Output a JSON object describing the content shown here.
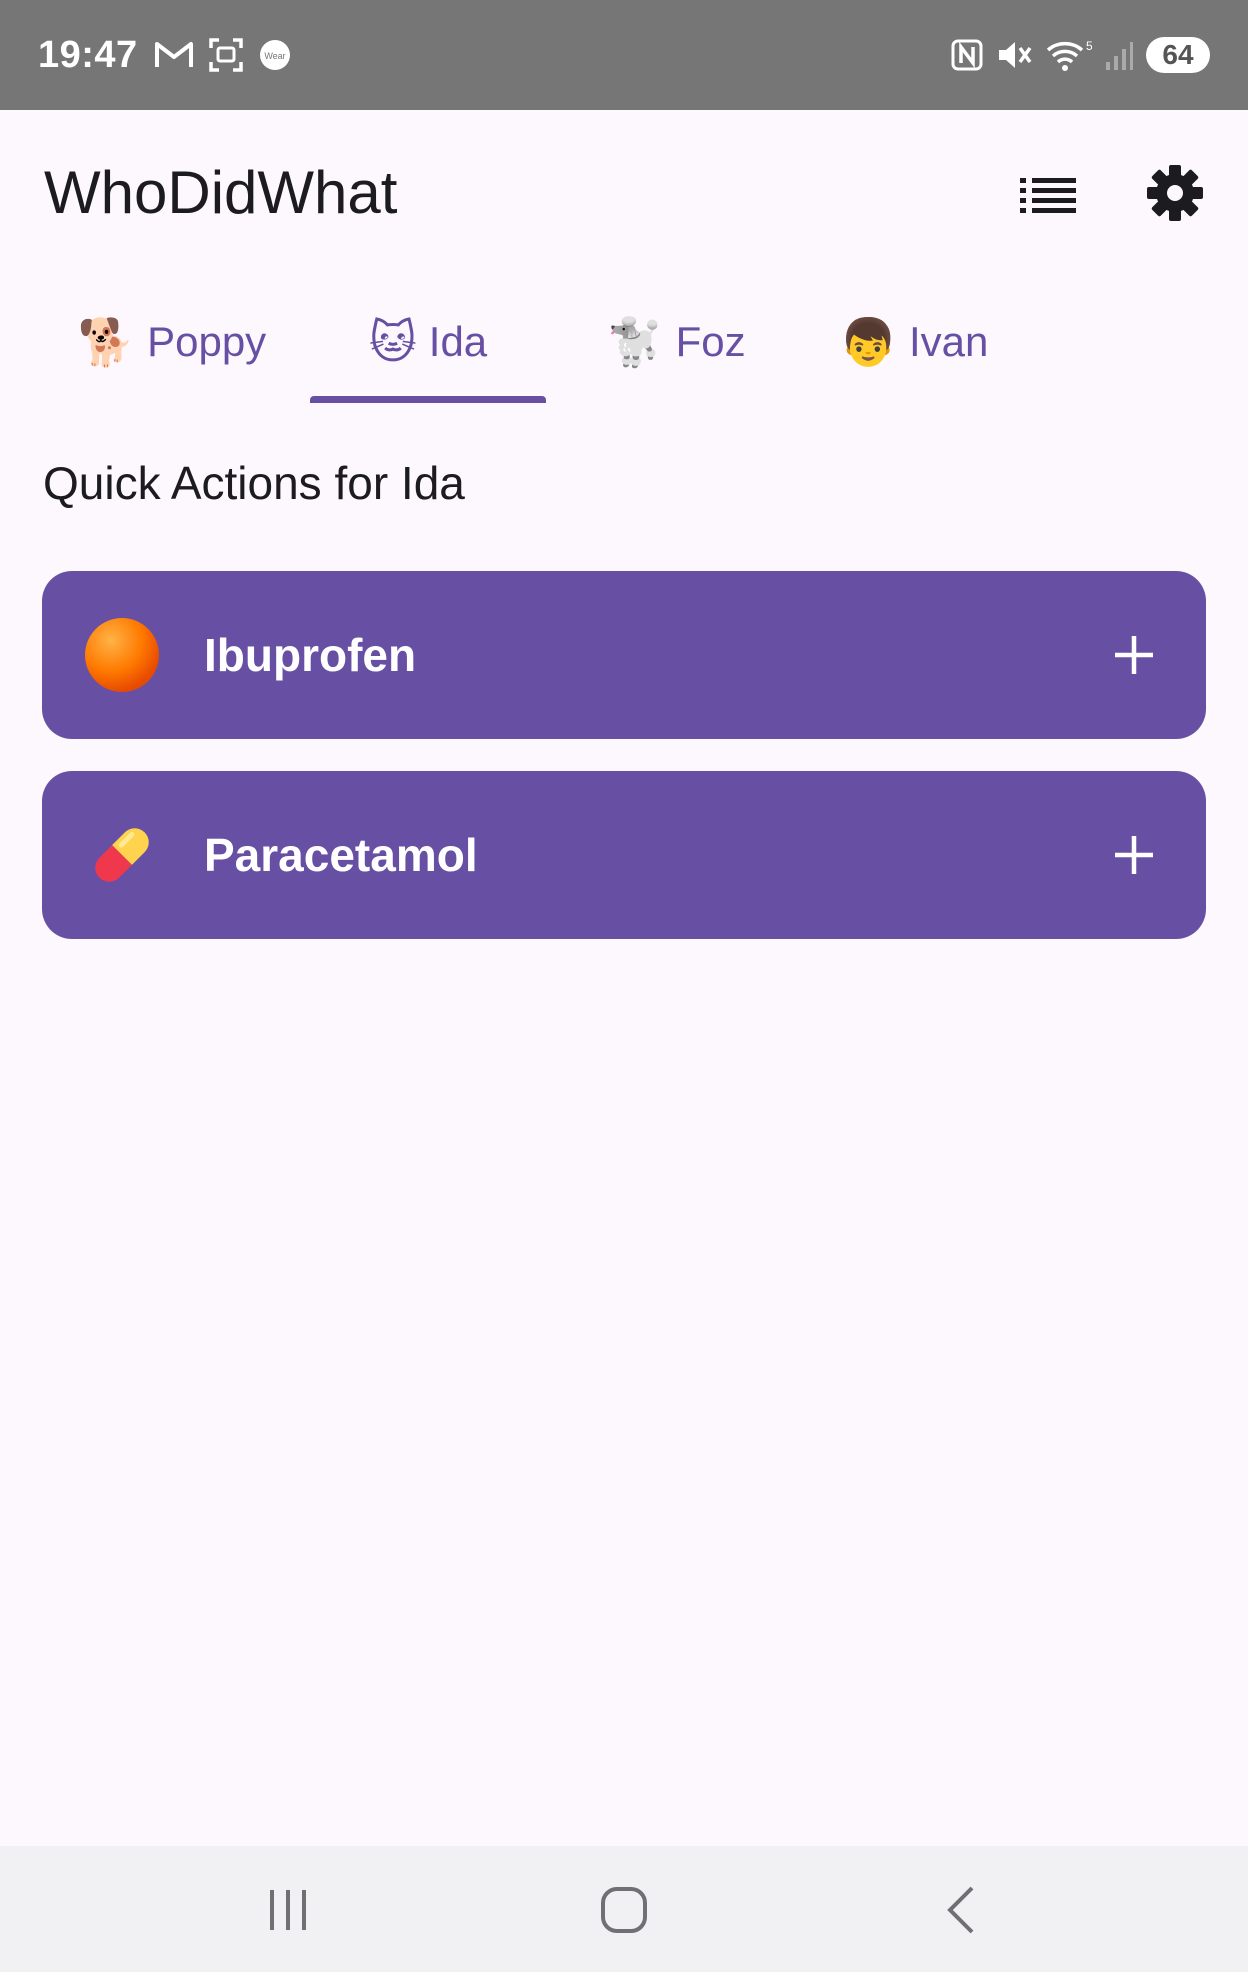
{
  "status_bar": {
    "time": "19:47",
    "left_icons": [
      "gmail-icon",
      "screenshot-icon",
      "wear-icon"
    ],
    "wear_label": "Wear",
    "right_icons": [
      "nfc-icon",
      "mute-icon",
      "wifi-icon",
      "signal-icon"
    ],
    "wifi_badge": "5",
    "battery": "64"
  },
  "app_bar": {
    "title": "WhoDidWhat",
    "actions": [
      "list-icon",
      "gear-icon"
    ]
  },
  "tabs": [
    {
      "emoji": "🐕",
      "label": "Poppy",
      "selected": false
    },
    {
      "emoji": "🐱",
      "label": "Ida",
      "selected": true
    },
    {
      "emoji": "🐩",
      "label": "Foz",
      "selected": false
    },
    {
      "emoji": "👦",
      "label": "Ivan",
      "selected": false
    }
  ],
  "section": {
    "title": "Quick Actions for Ida"
  },
  "actions": [
    {
      "icon": "orange-circle-icon",
      "label": "Ibuprofen",
      "button": "plus-icon"
    },
    {
      "icon": "pill-icon",
      "label": "Paracetamol",
      "button": "plus-icon"
    }
  ],
  "colors": {
    "primary": "#6750a4",
    "background": "#fdf8fd",
    "status_bar": "#767676",
    "nav_bar": "#f1f1f3"
  },
  "nav_bar": [
    "recents-icon",
    "home-icon",
    "back-icon"
  ]
}
